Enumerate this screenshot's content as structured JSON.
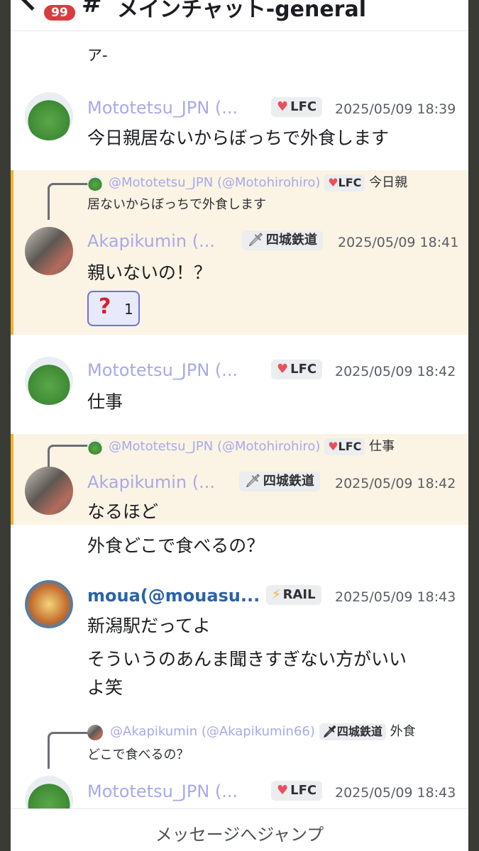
{
  "header": {
    "badge": "99",
    "hash": "#",
    "channel": "メインチャット-general"
  },
  "partial_text": "ア-",
  "roles": {
    "lfc": {
      "icon": "heart-icon",
      "label": "LFC",
      "color": "#e8505b"
    },
    "shijo": {
      "icon": "sword-icon",
      "label": "四城鉄道"
    },
    "rail": {
      "icon": "lightning-icon",
      "label": "RAIL"
    }
  },
  "messages": [
    {
      "name": "Mototetsu_JPN (...",
      "role": "LFC",
      "time": "2025/05/09 18:39",
      "text": "今日親居ないからぼっちで外食します"
    },
    {
      "reply": {
        "name": "@Mototetsu_JPN (@Motohirohiro)",
        "role": "LFC",
        "text1": "今日親",
        "text2": "居ないからぼっちで外食します"
      },
      "name": "Akapikumin (...",
      "role": "四城鉄道",
      "time": "2025/05/09 18:41",
      "text": "親いないの！？",
      "reaction": {
        "emoji": "?",
        "count": "1"
      }
    },
    {
      "name": "Mototetsu_JPN (...",
      "role": "LFC",
      "time": "2025/05/09 18:42",
      "text": "仕事"
    },
    {
      "reply": {
        "name": "@Mototetsu_JPN (@Motohirohiro)",
        "role": "LFC",
        "text": "仕事"
      },
      "name": "Akapikumin (...",
      "role": "四城鉄道",
      "time": "2025/05/09 18:42",
      "text": "なるほど",
      "text2": "外食どこで食べるの？"
    },
    {
      "name": "moua(@mouasu...",
      "role": "RAIL",
      "time": "2025/05/09 18:43",
      "text": "新潟駅だってよ",
      "text2": "そういうのあんま聞きすぎない方がいい",
      "text3": "よ笑"
    },
    {
      "reply": {
        "name": "@Akapikumin (@Akapikumin66)",
        "role": "四城鉄道",
        "text1": "外食",
        "text2": "どこで食べるの？"
      },
      "name": "Mototetsu_JPN (...",
      "role": "LFC",
      "time": "2025/05/09 18:43"
    }
  ],
  "jump_bar": {
    "label": "メッセージへジャンプ"
  }
}
